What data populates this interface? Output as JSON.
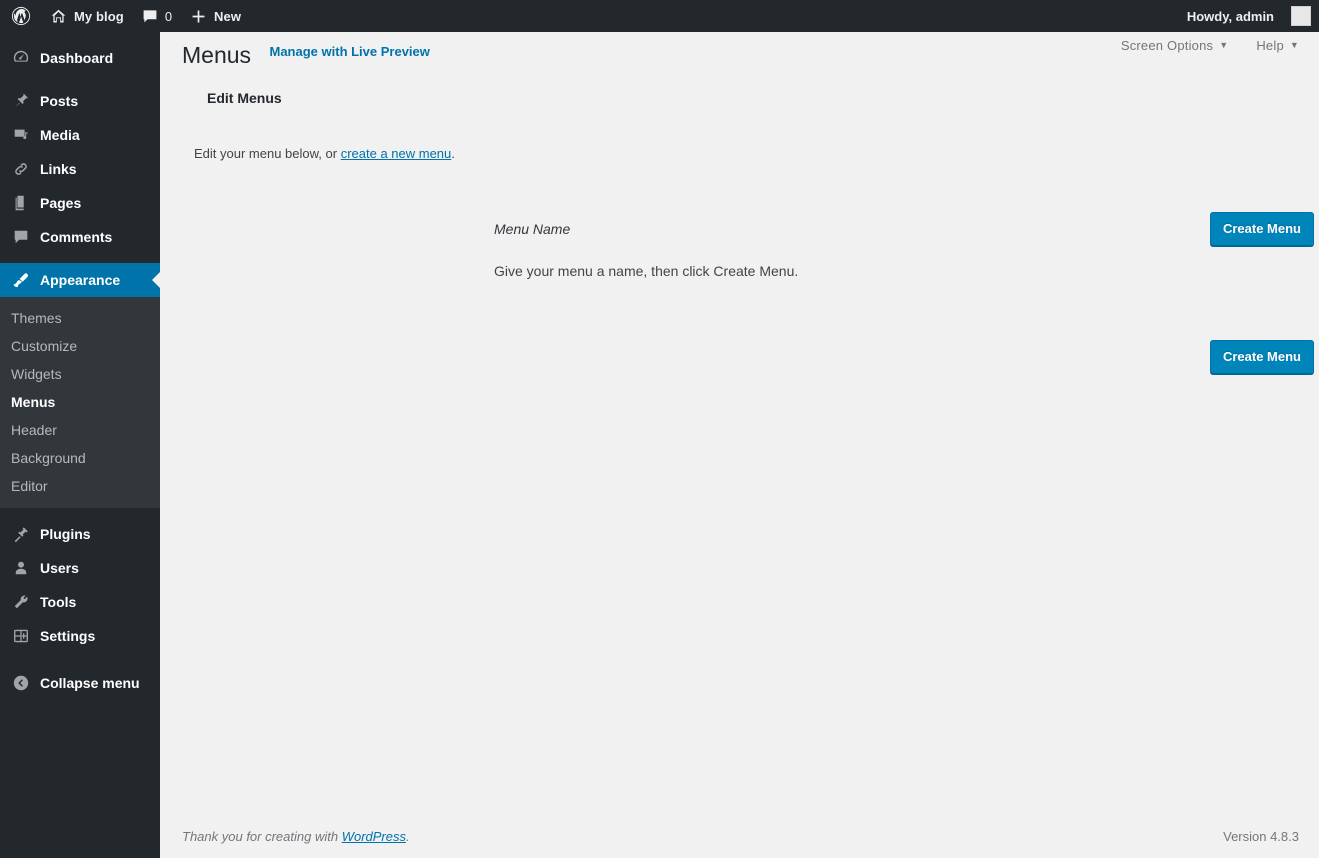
{
  "adminbar": {
    "logo_icon": "wordpress-logo-icon",
    "site_name": "My blog",
    "site_icon": "home-icon",
    "comments_icon": "comment-bubble-icon",
    "comments_count": "0",
    "new_icon": "plus-icon",
    "new_label": "New",
    "howdy": "Howdy, admin",
    "avatar_icon": "avatar-image"
  },
  "sidebar": {
    "items": [
      {
        "label": "Dashboard",
        "icon": "dashboard-icon",
        "current": false
      },
      {
        "label": "Posts",
        "icon": "pin-icon",
        "current": false
      },
      {
        "label": "Media",
        "icon": "media-camera-icon",
        "current": false
      },
      {
        "label": "Links",
        "icon": "link-chain-icon",
        "current": false
      },
      {
        "label": "Pages",
        "icon": "pages-icon",
        "current": false
      },
      {
        "label": "Comments",
        "icon": "comment-bubble-icon",
        "current": false
      },
      {
        "label": "Appearance",
        "icon": "paintbrush-icon",
        "current": true
      },
      {
        "label": "Plugins",
        "icon": "plug-icon",
        "current": false
      },
      {
        "label": "Users",
        "icon": "user-icon",
        "current": false
      },
      {
        "label": "Tools",
        "icon": "wrench-icon",
        "current": false
      },
      {
        "label": "Settings",
        "icon": "settings-sliders-icon",
        "current": false
      }
    ],
    "appearance_submenu": [
      {
        "label": "Themes",
        "current": false
      },
      {
        "label": "Customize",
        "current": false
      },
      {
        "label": "Widgets",
        "current": false
      },
      {
        "label": "Menus",
        "current": true
      },
      {
        "label": "Header",
        "current": false
      },
      {
        "label": "Background",
        "current": false
      },
      {
        "label": "Editor",
        "current": false
      }
    ],
    "collapse": {
      "label": "Collapse menu",
      "icon": "collapse-arrow-icon"
    }
  },
  "screen_meta": {
    "screen_options": "Screen Options",
    "help": "Help",
    "caret": "▼"
  },
  "page": {
    "title": "Menus",
    "title_action": "Manage with Live Preview",
    "tabs": [
      {
        "label": "Edit Menus",
        "active": true
      }
    ],
    "intro_before": "Edit your menu below, or ",
    "intro_link": "create a new menu",
    "intro_after": "."
  },
  "menu_editor": {
    "menu_name_label": "Menu Name",
    "menu_name_value": "",
    "menu_name_placeholder": "",
    "help_text": "Give your menu a name, then click Create Menu.",
    "create_button_top": "Create Menu",
    "create_button_bottom": "Create Menu"
  },
  "footer": {
    "thanks_before": "Thank you for creating with ",
    "thanks_link": "WordPress",
    "thanks_after": ".",
    "version": "Version 4.8.3"
  },
  "colors": {
    "admin_blue": "#0073aa",
    "button_blue": "#0085ba",
    "sidebar_dark": "#23282d",
    "submenu_dark": "#32373c",
    "content_bg": "#f1f1f1"
  }
}
